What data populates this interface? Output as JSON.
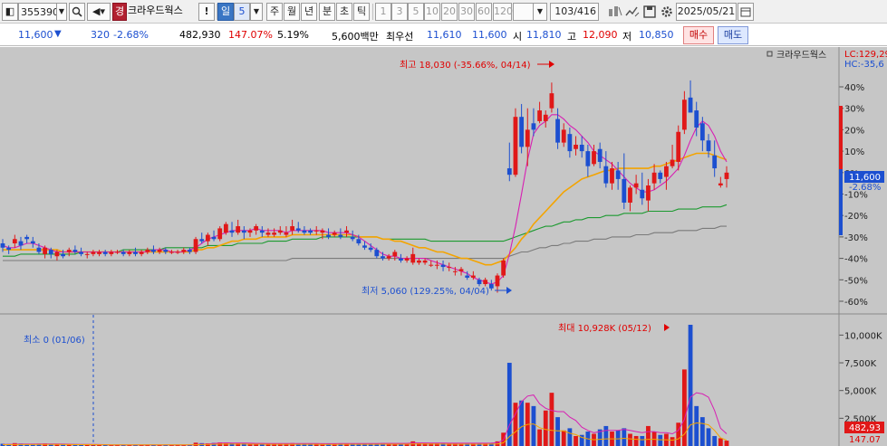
{
  "toolbar": {
    "code": "355390",
    "grade_badge": "경",
    "stock_name": "크라우드웍스",
    "alert_label": "!",
    "period_label": "일",
    "period_value": "5",
    "periods": [
      "주",
      "월",
      "년",
      "분",
      "초",
      "틱"
    ],
    "tick_counts": [
      "1",
      "3",
      "5",
      "10",
      "20",
      "30",
      "60",
      "120"
    ],
    "count_display": "103/416",
    "date": "2025/05/21"
  },
  "quote": {
    "price": "11,600",
    "price_arrow": "▼",
    "change": "320",
    "change_pct": "-2.68%",
    "volume": "482,930",
    "volume_ratio": "147.07%",
    "turnover": "5.19%",
    "amount": "5,600백만",
    "best_label": "최우선",
    "best_ask": "11,610",
    "best_bid": "11,600",
    "open_label": "시",
    "open": "11,810",
    "high_label": "고",
    "high": "12,090",
    "low_label": "저",
    "low": "10,850",
    "buy_button": "매수",
    "sell_button": "매도"
  },
  "colors": {
    "up": "#e01818",
    "down": "#1c4fd0",
    "ma5": "#d81fb3",
    "ma10": "#1020a0",
    "ma20": "#f4a400",
    "ma60": "#1c9a30",
    "ma120": "#7a7a7a",
    "panel_bg": "#c6c6c6"
  },
  "chart": {
    "legend": "크라우드웍스",
    "lc_label": "LC:129,29",
    "hc_label": "HC:-35,6",
    "price_tag": "11,600",
    "pct_tag": "-2.68%",
    "high_annotation": "최고 18,030 (-35.66%, 04/14)",
    "low_annotation": "최저 5,060 (129.25%, 04/04)",
    "vol_max_annotation": "최대 10,928K (05/12)",
    "vol_min_annotation": "최소 0 (01/06)",
    "vol_tag": "482,93",
    "vol_tag2": "147.07",
    "price_ticks": [
      "40%",
      "30%",
      "20%",
      "10%",
      "0%",
      "-10%",
      "-20%",
      "-30%",
      "-40%",
      "-50%",
      "-60%"
    ],
    "volume_ticks": [
      "10,000K",
      "7,500K",
      "5,000K",
      "2,500K"
    ]
  },
  "chart_data": {
    "type": "candlestick",
    "title": "크라우드웍스",
    "price_axis": "% change relative to the last close (11,600)",
    "price_range_pct": [
      -60,
      40
    ],
    "candles_pct": [
      [
        -33,
        -31,
        -37,
        -35
      ],
      [
        -35,
        -34,
        -38,
        -36
      ],
      [
        -33,
        -29,
        -35,
        -31
      ],
      [
        -32,
        -30,
        -36,
        -34
      ],
      [
        -30,
        -29,
        -33,
        -31
      ],
      [
        -32,
        -30,
        -35,
        -33
      ],
      [
        -35,
        -33,
        -38,
        -37
      ],
      [
        -38,
        -34,
        -40,
        -35
      ],
      [
        -36,
        -35,
        -40,
        -38
      ],
      [
        -39,
        -36,
        -41,
        -37
      ],
      [
        -38,
        -36,
        -40,
        -39
      ],
      [
        -37,
        -35,
        -39,
        -36
      ],
      [
        -36,
        -34,
        -38,
        -37
      ],
      [
        -37,
        -35,
        -39,
        -38
      ],
      [
        -38,
        -37,
        -40,
        -38
      ],
      [
        -38,
        -36,
        -39,
        -37
      ],
      [
        -38,
        -36,
        -39,
        -37
      ],
      [
        -37,
        -36,
        -39,
        -38
      ],
      [
        -38,
        -36,
        -39,
        -37
      ],
      [
        -37,
        -36,
        -38,
        -37
      ],
      [
        -37,
        -36,
        -39,
        -38
      ],
      [
        -38,
        -36,
        -39,
        -37
      ],
      [
        -37,
        -35,
        -39,
        -38
      ],
      [
        -38,
        -36,
        -39,
        -37
      ],
      [
        -37,
        -35,
        -38,
        -36
      ],
      [
        -36,
        -34,
        -38,
        -37
      ],
      [
        -37,
        -35,
        -38,
        -36
      ],
      [
        -36,
        -35,
        -38,
        -37
      ],
      [
        -37,
        -36,
        -38,
        -37
      ],
      [
        -37,
        -36,
        -38,
        -37
      ],
      [
        -37,
        -35,
        -38,
        -36
      ],
      [
        -36,
        -35,
        -38,
        -37
      ],
      [
        -37,
        -30,
        -38,
        -31
      ],
      [
        -31,
        -28,
        -33,
        -32
      ],
      [
        -32,
        -28,
        -34,
        -29
      ],
      [
        -30,
        -27,
        -32,
        -31
      ],
      [
        -31,
        -25,
        -32,
        -26
      ],
      [
        -28,
        -23,
        -29,
        -24
      ],
      [
        -27,
        -23,
        -30,
        -28
      ],
      [
        -28,
        -22,
        -29,
        -25
      ],
      [
        -27,
        -25,
        -31,
        -28
      ],
      [
        -28,
        -26,
        -30,
        -27
      ],
      [
        -27,
        -24,
        -29,
        -25
      ],
      [
        -27,
        -25,
        -30,
        -28
      ],
      [
        -29,
        -26,
        -30,
        -28
      ],
      [
        -29,
        -26,
        -30,
        -28
      ],
      [
        -28,
        -25,
        -29,
        -27
      ],
      [
        -29,
        -25,
        -30,
        -28
      ],
      [
        -27,
        -22,
        -29,
        -25
      ],
      [
        -26,
        -23,
        -28,
        -27
      ],
      [
        -27,
        -25,
        -29,
        -28
      ],
      [
        -27,
        -26,
        -29,
        -28
      ],
      [
        -27,
        -25,
        -29,
        -27
      ],
      [
        -28,
        -26,
        -31,
        -27
      ],
      [
        -29,
        -26,
        -31,
        -30
      ],
      [
        -29,
        -27,
        -30,
        -28
      ],
      [
        -29,
        -26,
        -31,
        -30
      ],
      [
        -28,
        -25,
        -30,
        -27
      ],
      [
        -30,
        -27,
        -32,
        -31
      ],
      [
        -31,
        -29,
        -34,
        -33
      ],
      [
        -34,
        -32,
        -36,
        -35
      ],
      [
        -35,
        -33,
        -37,
        -36
      ],
      [
        -36,
        -35,
        -40,
        -39
      ],
      [
        -39,
        -37,
        -41,
        -40
      ],
      [
        -40,
        -38,
        -41,
        -39
      ],
      [
        -39,
        -36,
        -41,
        -37
      ],
      [
        -40,
        -38,
        -42,
        -41
      ],
      [
        -41,
        -39,
        -42,
        -40
      ],
      [
        -42,
        -35,
        -43,
        -38
      ],
      [
        -42,
        -40,
        -43,
        -41
      ],
      [
        -42,
        -40,
        -43,
        -41
      ],
      [
        -43,
        -41,
        -44,
        -43
      ],
      [
        -43,
        -41,
        -45,
        -43
      ],
      [
        -43,
        -41,
        -46,
        -44
      ],
      [
        -44,
        -42,
        -46,
        -44
      ],
      [
        -46,
        -44,
        -48,
        -46
      ],
      [
        -46,
        -44,
        -48,
        -45
      ],
      [
        -48,
        -46,
        -50,
        -49
      ],
      [
        -49,
        -46,
        -50,
        -48
      ],
      [
        -50,
        -49,
        -53,
        -52
      ],
      [
        -52,
        -49,
        -53,
        -50
      ],
      [
        -52,
        -50,
        -55,
        -54
      ],
      [
        -53,
        -47,
        -56,
        -48
      ],
      [
        -48,
        -40,
        -49,
        -41
      ],
      [
        2,
        14,
        -4,
        -1
      ],
      [
        -1,
        30,
        -2,
        26
      ],
      [
        26,
        32,
        9,
        12
      ],
      [
        12,
        30,
        3,
        20
      ],
      [
        23,
        30,
        17,
        20
      ],
      [
        24,
        33,
        23,
        29
      ],
      [
        24,
        29,
        21,
        27
      ],
      [
        30,
        42,
        28,
        37
      ],
      [
        25,
        30,
        11,
        14
      ],
      [
        14,
        23,
        12,
        20
      ],
      [
        18,
        21,
        7,
        10
      ],
      [
        11,
        17,
        8,
        13
      ],
      [
        13,
        17,
        7,
        10
      ],
      [
        10,
        13,
        -2,
        3
      ],
      [
        4,
        13,
        3,
        10
      ],
      [
        11,
        14,
        2,
        5
      ],
      [
        3,
        10,
        -7,
        -5
      ],
      [
        -5,
        5,
        -8,
        2
      ],
      [
        1,
        5,
        -8,
        -3
      ],
      [
        -3,
        9,
        -17,
        -14
      ],
      [
        -14,
        -6,
        -18,
        -7
      ],
      [
        -7,
        -1,
        -10,
        -5
      ],
      [
        -8,
        0,
        -15,
        -12
      ],
      [
        -13,
        -3,
        -18,
        -6
      ],
      [
        -5,
        4,
        -8,
        0
      ],
      [
        0,
        1,
        -5,
        -3
      ],
      [
        -2,
        5,
        -8,
        3
      ],
      [
        3,
        13,
        2,
        6
      ],
      [
        5,
        22,
        1,
        19
      ],
      [
        20,
        38,
        18,
        34
      ],
      [
        35,
        43,
        28,
        28
      ],
      [
        29,
        33,
        17,
        21
      ],
      [
        23,
        26,
        10,
        15
      ],
      [
        15,
        18,
        7,
        10
      ],
      [
        8,
        15,
        -2,
        2
      ],
      [
        -6,
        -2,
        -7,
        -5
      ],
      [
        -3,
        3,
        -7,
        0
      ]
    ],
    "ma5_pct": [
      -34,
      -35,
      -35,
      -34,
      -33,
      -33,
      -34,
      -35,
      -36,
      -37,
      -37,
      -37,
      -37,
      -37,
      -37,
      -37,
      -37,
      -37,
      -37,
      -37,
      -37,
      -37,
      -37,
      -37,
      -37,
      -36,
      -36,
      -36,
      -37,
      -37,
      -37,
      -36,
      -35,
      -33,
      -31,
      -30,
      -29,
      -28,
      -27,
      -27,
      -27,
      -27,
      -26,
      -27,
      -27,
      -27,
      -27,
      -28,
      -27,
      -27,
      -27,
      -27,
      -27,
      -27,
      -28,
      -28,
      -28,
      -28,
      -29,
      -30,
      -32,
      -34,
      -36,
      -38,
      -39,
      -39,
      -40,
      -40,
      -40,
      -40,
      -40,
      -41,
      -42,
      -43,
      -44,
      -45,
      -46,
      -47,
      -49,
      -50,
      -51,
      -52,
      -51,
      -48,
      -38,
      -25,
      -10,
      6,
      18,
      22,
      24,
      27,
      27,
      25,
      22,
      20,
      17,
      14,
      10,
      8,
      6,
      4,
      1,
      -2,
      -5,
      -7,
      -9,
      -9,
      -8,
      -6,
      -4,
      -1,
      2,
      8,
      15,
      21,
      24,
      22,
      17,
      10,
      5
    ],
    "ma20_pct": [
      -36,
      -36,
      -36,
      -36,
      -36,
      -36,
      -36,
      -36,
      -36,
      -36,
      -37,
      -37,
      -37,
      -37,
      -37,
      -37,
      -37,
      -37,
      -37,
      -37,
      -37,
      -37,
      -37,
      -37,
      -37,
      -37,
      -37,
      -37,
      -37,
      -37,
      -37,
      -37,
      -36,
      -36,
      -35,
      -35,
      -34,
      -33,
      -32,
      -32,
      -31,
      -31,
      -31,
      -30,
      -30,
      -30,
      -30,
      -30,
      -29,
      -29,
      -29,
      -29,
      -29,
      -29,
      -29,
      -29,
      -29,
      -29,
      -29,
      -30,
      -30,
      -30,
      -30,
      -31,
      -31,
      -32,
      -32,
      -33,
      -34,
      -35,
      -35,
      -36,
      -37,
      -37,
      -38,
      -39,
      -40,
      -40,
      -41,
      -42,
      -43,
      -43,
      -42,
      -41,
      -38,
      -35,
      -31,
      -28,
      -24,
      -21,
      -18,
      -15,
      -12,
      -9,
      -7,
      -5,
      -3,
      -2,
      -1,
      0,
      1,
      1,
      2,
      2,
      2,
      2,
      2,
      2,
      3,
      3,
      4,
      5,
      6,
      7,
      8,
      9,
      9,
      9,
      8,
      7,
      6
    ],
    "ma60_pct": [
      -39,
      -39,
      -39,
      -38,
      -38,
      -38,
      -38,
      -38,
      -38,
      -38,
      -38,
      -38,
      -38,
      -37,
      -37,
      -37,
      -37,
      -37,
      -37,
      -37,
      -36,
      -36,
      -36,
      -36,
      -36,
      -36,
      -36,
      -35,
      -35,
      -35,
      -35,
      -35,
      -35,
      -35,
      -34,
      -34,
      -34,
      -34,
      -34,
      -33,
      -33,
      -33,
      -33,
      -33,
      -32,
      -32,
      -32,
      -32,
      -31,
      -31,
      -31,
      -31,
      -31,
      -30,
      -30,
      -30,
      -30,
      -30,
      -30,
      -30,
      -30,
      -30,
      -30,
      -31,
      -31,
      -31,
      -31,
      -31,
      -31,
      -31,
      -31,
      -32,
      -32,
      -32,
      -32,
      -32,
      -32,
      -32,
      -32,
      -32,
      -32,
      -32,
      -32,
      -32,
      -31,
      -30,
      -29,
      -28,
      -27,
      -26,
      -25,
      -25,
      -24,
      -23,
      -23,
      -22,
      -22,
      -21,
      -21,
      -21,
      -20,
      -20,
      -20,
      -19,
      -19,
      -19,
      -19,
      -18,
      -18,
      -18,
      -18,
      -18,
      -17,
      -17,
      -17,
      -17,
      -16,
      -16,
      -16,
      -16,
      -15
    ],
    "ma120_pct": [
      -41,
      -41,
      -41,
      -41,
      -41,
      -41,
      -41,
      -41,
      -41,
      -41,
      -41,
      -41,
      -41,
      -41,
      -41,
      -41,
      -41,
      -41,
      -41,
      -41,
      -41,
      -41,
      -41,
      -41,
      -41,
      -41,
      -41,
      -41,
      -41,
      -41,
      -41,
      -41,
      -41,
      -41,
      -41,
      -41,
      -41,
      -41,
      -41,
      -41,
      -41,
      -41,
      -41,
      -41,
      -41,
      -41,
      -41,
      -41,
      -40,
      -40,
      -40,
      -40,
      -40,
      -40,
      -40,
      -40,
      -40,
      -40,
      -40,
      -40,
      -40,
      -40,
      -40,
      -40,
      -40,
      -40,
      -40,
      -40,
      -40,
      -40,
      -40,
      -40,
      -40,
      -40,
      -40,
      -40,
      -40,
      -40,
      -40,
      -40,
      -40,
      -40,
      -40,
      -40,
      -39,
      -38,
      -37,
      -37,
      -36,
      -35,
      -35,
      -34,
      -34,
      -33,
      -33,
      -32,
      -32,
      -32,
      -31,
      -31,
      -31,
      -30,
      -30,
      -30,
      -30,
      -29,
      -29,
      -29,
      -28,
      -28,
      -28,
      -28,
      -27,
      -27,
      -27,
      -27,
      -26,
      -26,
      -26,
      -25,
      -25
    ],
    "volume_range_k": [
      0,
      11500
    ],
    "volumes_k": [
      200,
      180,
      260,
      220,
      150,
      170,
      210,
      230,
      190,
      160,
      140,
      150,
      170,
      130,
      120,
      140,
      110,
      100,
      90,
      100,
      80,
      90,
      100,
      110,
      95,
      100,
      90,
      80,
      85,
      90,
      100,
      120,
      300,
      260,
      240,
      280,
      320,
      300,
      250,
      270,
      240,
      220,
      230,
      250,
      210,
      220,
      200,
      210,
      260,
      240,
      230,
      210,
      200,
      190,
      220,
      210,
      230,
      240,
      200,
      210,
      220,
      230,
      240,
      260,
      250,
      230,
      240,
      250,
      420,
      280,
      260,
      240,
      250,
      260,
      240,
      250,
      230,
      250,
      240,
      260,
      250,
      270,
      420,
      1200,
      7500,
      3900,
      4100,
      3900,
      3600,
      1500,
      3200,
      4800,
      2600,
      1400,
      1600,
      900,
      1000,
      1300,
      1100,
      1500,
      1800,
      1300,
      1400,
      1600,
      1100,
      900,
      900,
      1800,
      1300,
      1000,
      1100,
      800,
      2100,
      6900,
      10928,
      3600,
      2600,
      1600,
      900,
      700,
      483
    ],
    "volume_ma_k": [
      150,
      150,
      160,
      170,
      170,
      170,
      180,
      190,
      190,
      180,
      170,
      160,
      150,
      150,
      140,
      140,
      130,
      120,
      110,
      110,
      100,
      100,
      100,
      100,
      100,
      100,
      100,
      95,
      95,
      95,
      95,
      100,
      130,
      160,
      180,
      220,
      260,
      280,
      270,
      270,
      260,
      250,
      240,
      240,
      230,
      230,
      220,
      220,
      230,
      230,
      230,
      220,
      220,
      210,
      210,
      210,
      220,
      220,
      220,
      220,
      220,
      220,
      230,
      240,
      240,
      240,
      240,
      240,
      280,
      280,
      280,
      270,
      270,
      260,
      250,
      250,
      250,
      250,
      250,
      250,
      250,
      260,
      290,
      530,
      1900,
      2900,
      4000,
      4500,
      4600,
      3800,
      3400,
      3200,
      3100,
      3100,
      2600,
      2300,
      1700,
      1400,
      1200,
      1300,
      1400,
      1400,
      1400,
      1500,
      1400,
      1300,
      1200,
      1300,
      1300,
      1200,
      1200,
      1100,
      1400,
      2400,
      4400,
      4800,
      4700,
      4400,
      3200,
      1600,
      1100
    ]
  }
}
